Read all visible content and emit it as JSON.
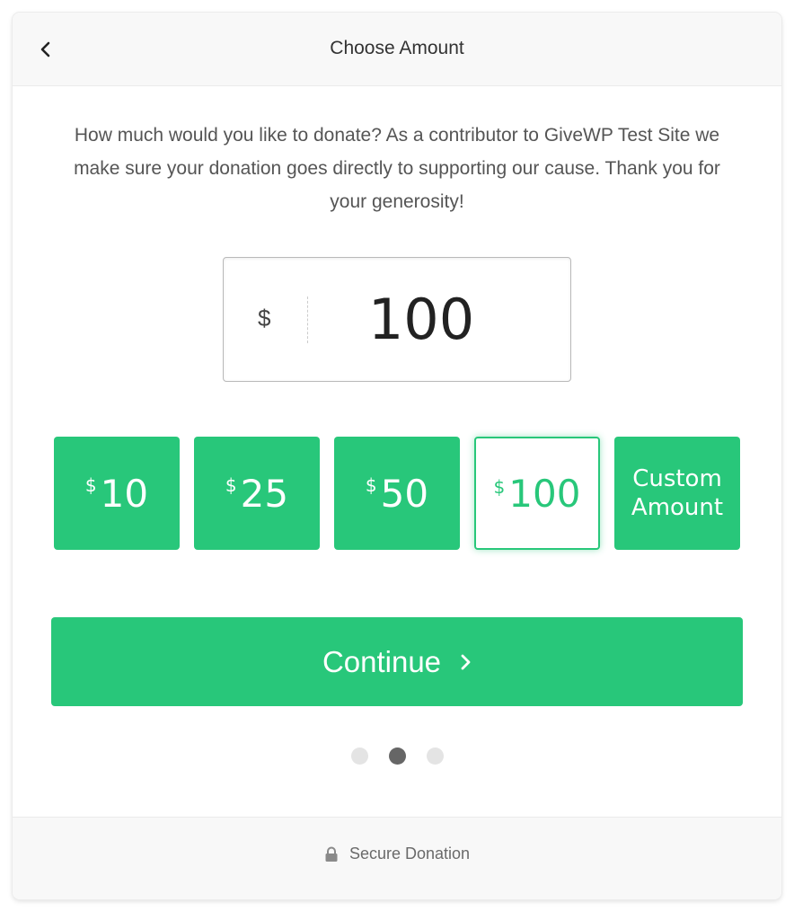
{
  "header": {
    "title": "Choose Amount",
    "back_icon": "chevron-left-icon"
  },
  "description": "How much would you like to donate? As a contributor to GiveWP Test Site we make sure your donation goes directly to supporting our cause. Thank you for your generosity!",
  "amount": {
    "currency_symbol": "$",
    "value": "100"
  },
  "levels": [
    {
      "symbol": "$",
      "value": "10",
      "selected": false
    },
    {
      "symbol": "$",
      "value": "25",
      "selected": false
    },
    {
      "symbol": "$",
      "value": "50",
      "selected": false
    },
    {
      "symbol": "$",
      "value": "100",
      "selected": true
    },
    {
      "label_line1": "Custom",
      "label_line2": "Amount",
      "custom": true
    }
  ],
  "continue": {
    "label": "Continue",
    "icon": "chevron-right-icon"
  },
  "pagination": {
    "total": 3,
    "active_index": 1
  },
  "footer": {
    "icon": "lock-icon",
    "label": "Secure Donation"
  },
  "colors": {
    "accent": "#28c77a",
    "text": "#333333",
    "header_bg": "#f8f8f8"
  }
}
